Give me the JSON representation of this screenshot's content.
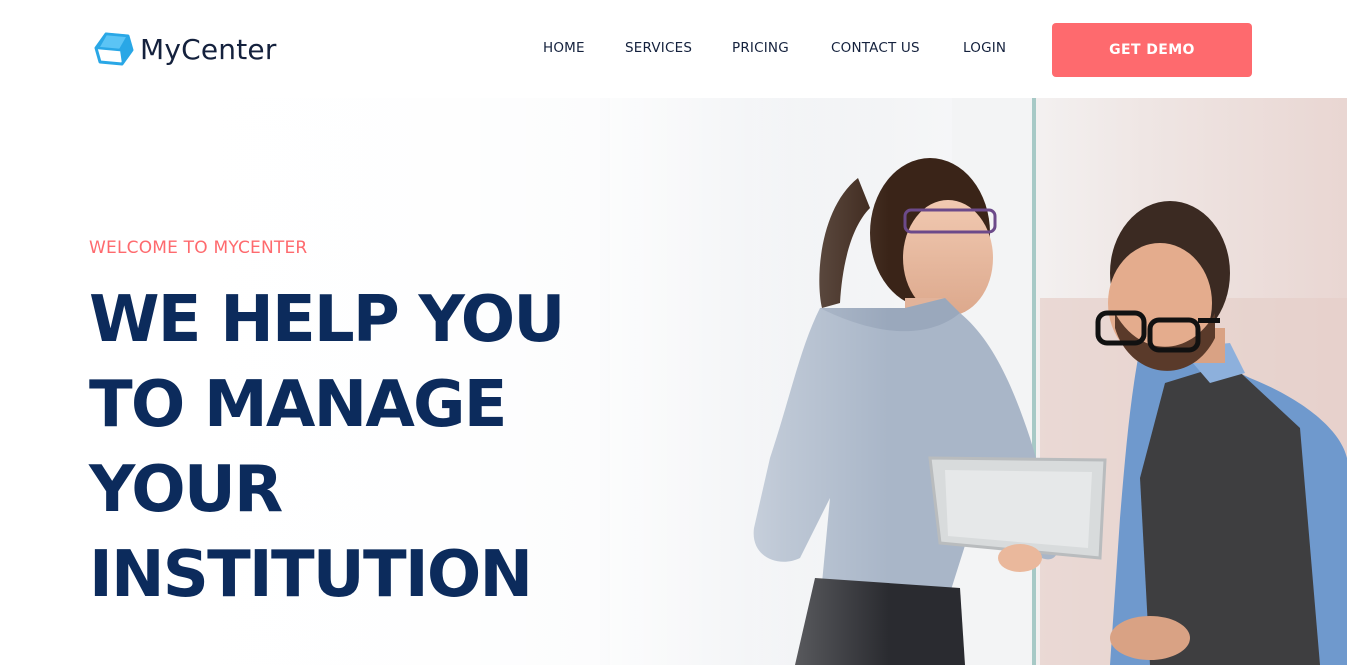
{
  "brand": {
    "name": "MyCenter",
    "icon": "cube-logo-icon"
  },
  "nav": {
    "items": [
      {
        "label": "HOME"
      },
      {
        "label": "SERVICES"
      },
      {
        "label": "PRICING"
      },
      {
        "label": "CONTACT US"
      },
      {
        "label": "LOGIN"
      }
    ],
    "cta_label": "GET DEMO"
  },
  "hero": {
    "eyebrow": "WELCOME TO MYCENTER",
    "headline_lines": [
      "WE HELP YOU",
      "TO MANAGE",
      "YOUR",
      "INSTITUTION"
    ]
  },
  "colors": {
    "accent": "#fe6a6e",
    "headline": "#0c2b5c",
    "nav_text": "#14213d",
    "logo_blue": "#29a7e6"
  }
}
